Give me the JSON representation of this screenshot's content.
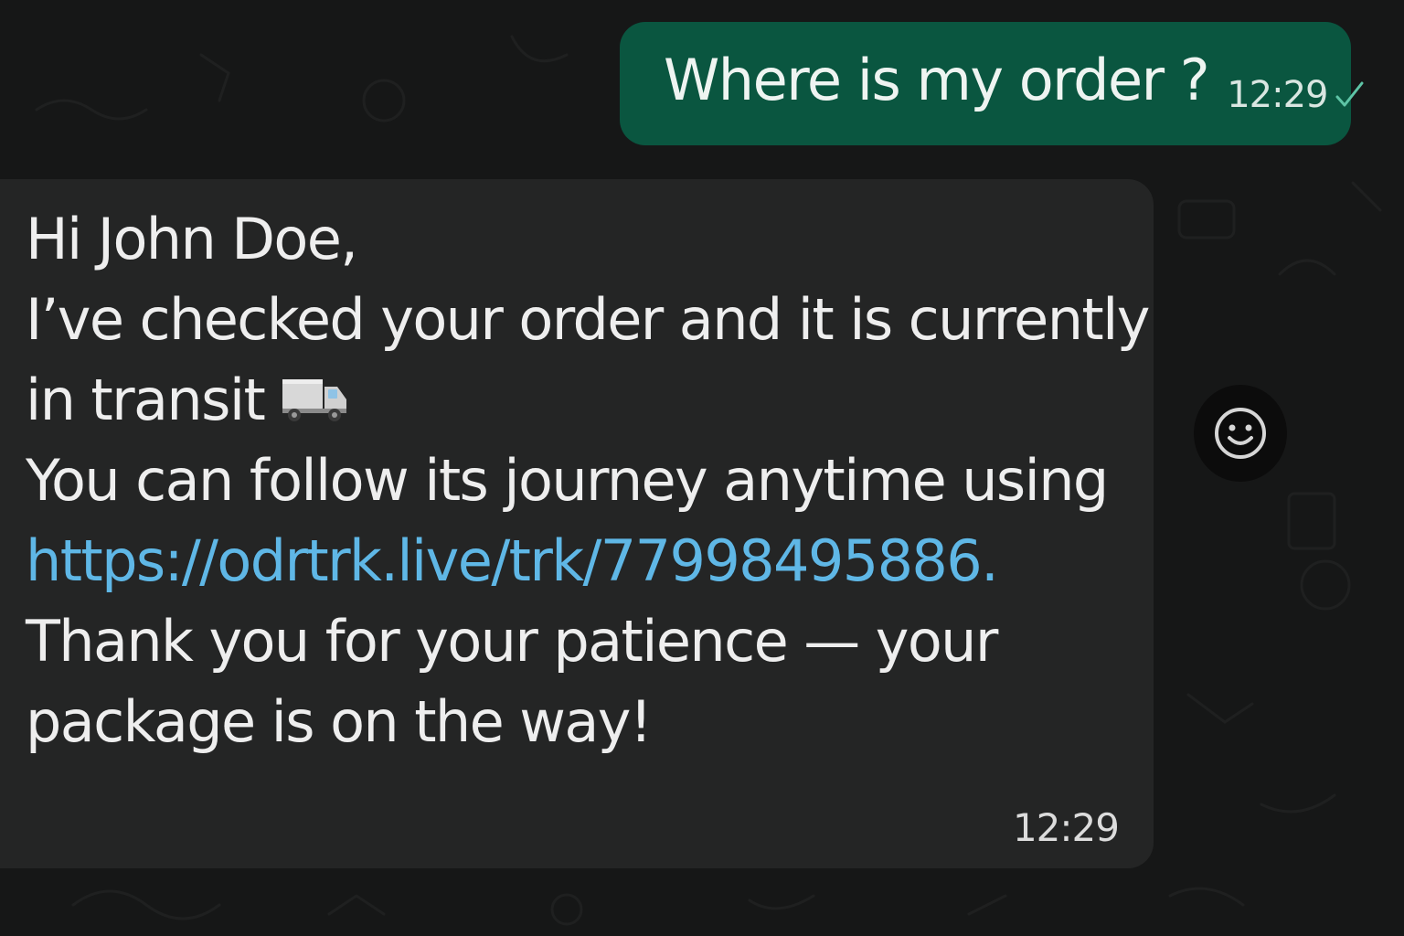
{
  "colors": {
    "background": "#161717",
    "outgoing_bubble": "#0a5640",
    "incoming_bubble": "#242525",
    "link": "#5fb7e6",
    "read_check": "#5ec4a6"
  },
  "outgoing": {
    "text": "Where is my order ?",
    "time": "12:29",
    "status_icon": "single-check-icon"
  },
  "incoming": {
    "line1": "Hi John Doe,",
    "line2": "I’ve checked your order and it is currently",
    "line3": "in transit",
    "line3_emoji": "truck-icon",
    "line4": "You can follow its journey anytime using",
    "link": "https://odrtrk.live/trk/77998495886.",
    "line6": "Thank you for your patience — your",
    "line7": "package is on the way!",
    "time": "12:29"
  },
  "reaction_button": {
    "icon": "smiley-icon"
  }
}
